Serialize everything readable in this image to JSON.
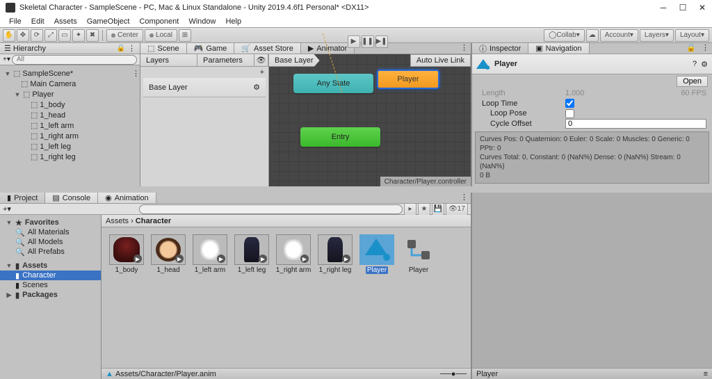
{
  "window": {
    "title": "Skeletal Character - SampleScene - PC, Mac & Linux Standalone - Unity 2019.4.6f1 Personal* <DX11>",
    "menu": [
      "File",
      "Edit",
      "Assets",
      "GameObject",
      "Component",
      "Window",
      "Help"
    ]
  },
  "toolbar": {
    "center": "Center",
    "local": "Local",
    "collab": "Collab",
    "account": "Account",
    "layers": "Layers",
    "layout": "Layout"
  },
  "hierarchy": {
    "title": "Hierarchy",
    "search_placeholder": "All",
    "scene": "SampleScene*",
    "items": [
      "Main Camera",
      "Player",
      "1_body",
      "1_head",
      "1_left arm",
      "1_right arm",
      "1_left leg",
      "1_right leg"
    ]
  },
  "center_tabs": [
    "Scene",
    "Game",
    "Asset Store",
    "Animator"
  ],
  "animator": {
    "layers_tab": "Layers",
    "params_tab": "Parameters",
    "breadcrumb": "Base Layer",
    "autolive": "Auto Live Link",
    "layer_row": "Base Layer",
    "nodes": {
      "any": "Any State",
      "entry": "Entry",
      "player": "Player"
    },
    "status": "Character/Player.controller"
  },
  "inspector": {
    "tabs": [
      "Inspector",
      "Navigation"
    ],
    "name": "Player",
    "open": "Open",
    "length_label": "Length",
    "length_value": "1.000",
    "fps": "60 FPS",
    "loop_time": "Loop Time",
    "loop_pose": "Loop Pose",
    "cycle_offset": "Cycle Offset",
    "cycle_value": "0",
    "curves1": "Curves Pos: 0 Quaternion: 0 Euler: 0 Scale: 0 Muscles: 0 Generic: 0 PPtr: 0",
    "curves2": "Curves Total: 0, Constant: 0 (NaN%) Dense: 0 (NaN%) Stream: 0 (NaN%)",
    "curves3": "0 B"
  },
  "project": {
    "tabs": [
      "Project",
      "Console",
      "Animation"
    ],
    "count": "17",
    "favorites": "Favorites",
    "fav_items": [
      "All Materials",
      "All Models",
      "All Prefabs"
    ],
    "assets": "Assets",
    "asset_folders": [
      "Character",
      "Scenes"
    ],
    "packages": "Packages",
    "path": [
      "Assets",
      "Character"
    ],
    "grid": [
      "1_body",
      "1_head",
      "1_left arm",
      "1_left leg",
      "1_right arm",
      "1_right leg",
      "Player",
      "Player"
    ],
    "footer": "Assets/Character/Player.anim",
    "preview": "Player"
  }
}
